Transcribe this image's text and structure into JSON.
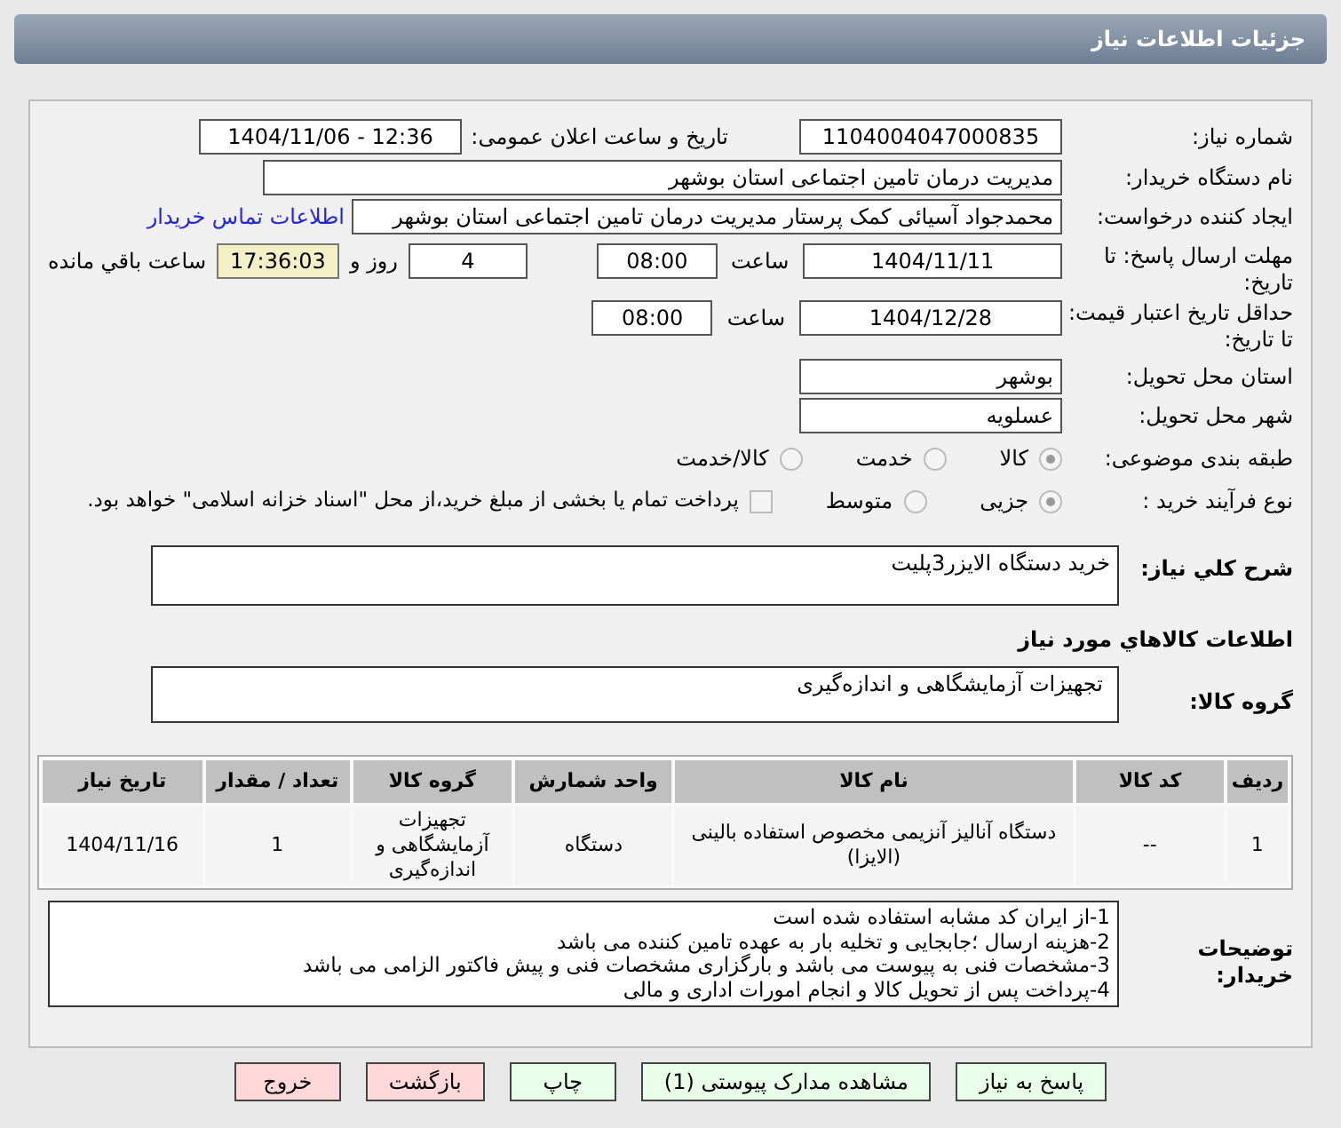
{
  "header": {
    "title": "جزئیات اطلاعات نیاز"
  },
  "need_number": {
    "label": "شماره نیاز:",
    "value": "1104004047000835"
  },
  "announce": {
    "label": "تاریخ و ساعت اعلان عمومی:",
    "value": "1404/11/06 - 12:36"
  },
  "buyer_org": {
    "label": "نام دستگاه خریدار:",
    "value": "مدیریت درمان تامین اجتماعی استان بوشهر"
  },
  "requester": {
    "label": "ایجاد کننده درخواست:",
    "value": "محمدجواد آسیائی کمک پرستار مدیریت درمان تامین اجتماعی استان بوشهر",
    "link": "اطلاعات تماس خریدار"
  },
  "deadline": {
    "label": "مهلت ارسال پاسخ: تا تاریخ:",
    "date": "1404/11/11",
    "time_label": "ساعت",
    "time": "08:00",
    "days": "4",
    "days_suffix": "روز و",
    "remaining": "17:36:03",
    "remaining_suffix": "ساعت باقي مانده"
  },
  "validity": {
    "label": "حداقل تاریخ اعتبار قیمت: تا تاریخ:",
    "date": "1404/12/28",
    "time_label": "ساعت",
    "time": "08:00"
  },
  "province": {
    "label": "استان محل تحویل:",
    "value": "بوشهر"
  },
  "city": {
    "label": "شهر محل تحویل:",
    "value": "عسلویه"
  },
  "category": {
    "label": "طبقه بندی موضوعی:",
    "options": [
      {
        "label": "کالا",
        "selected": true
      },
      {
        "label": "خدمت",
        "selected": false
      },
      {
        "label": "کالا/خدمت",
        "selected": false
      }
    ]
  },
  "process": {
    "label": "نوع فرآیند خرید :",
    "options": [
      {
        "label": "جزیی",
        "selected": true
      },
      {
        "label": "متوسط",
        "selected": false
      }
    ],
    "payment": {
      "checked": false,
      "label": "پرداخت تمام یا بخشی از مبلغ خرید،از محل \"اسناد خزانه اسلامی\" خواهد بود."
    }
  },
  "description": {
    "label": "شرح کلي نياز:",
    "value": "خرید دستگاه الایزر3پلیت"
  },
  "goods_title": "اطلاعات کالاهاي مورد نياز",
  "goods_group": {
    "label": "گروه کالا:",
    "value": "تجهیزات آزمایشگاهی و اندازه‌گیری"
  },
  "table": {
    "columns": [
      "ردیف",
      "کد کالا",
      "نام کالا",
      "واحد شمارش",
      "گروه کالا",
      "تعداد / مقدار",
      "تاریخ نیاز"
    ],
    "rows": [
      [
        "1",
        "--",
        "دستگاه آنالیز آنزیمی مخصوص استفاده بالینی (الایزا)",
        "دستگاه",
        "تجهیزات آزمایشگاهی و اندازه‌گیری",
        "1",
        "1404/11/16"
      ]
    ]
  },
  "buyer_notes": {
    "label": "توضیحات خریدار:",
    "lines": [
      "1-از ایران کد مشابه استفاده شده است",
      "2-هزینه ارسال ؛جابجایی و تخلیه بار به عهده تامین کننده می باشد",
      "3-مشخصات فنی به پیوست می باشد و بارگزاری مشخصات فنی و پیش فاکتور الزامی می باشد",
      "4-پرداخت پس از تحویل کالا و انجام امورات اداری و مالی"
    ]
  },
  "buttons": [
    {
      "label": "پاسخ به نیاز",
      "kind": "primary"
    },
    {
      "label": "مشاهده مدارک پیوستی (1)",
      "kind": "primary"
    },
    {
      "label": "چاپ",
      "kind": "primary"
    },
    {
      "label": "بازگشت",
      "kind": "danger"
    },
    {
      "label": "خروج",
      "kind": "danger"
    }
  ]
}
